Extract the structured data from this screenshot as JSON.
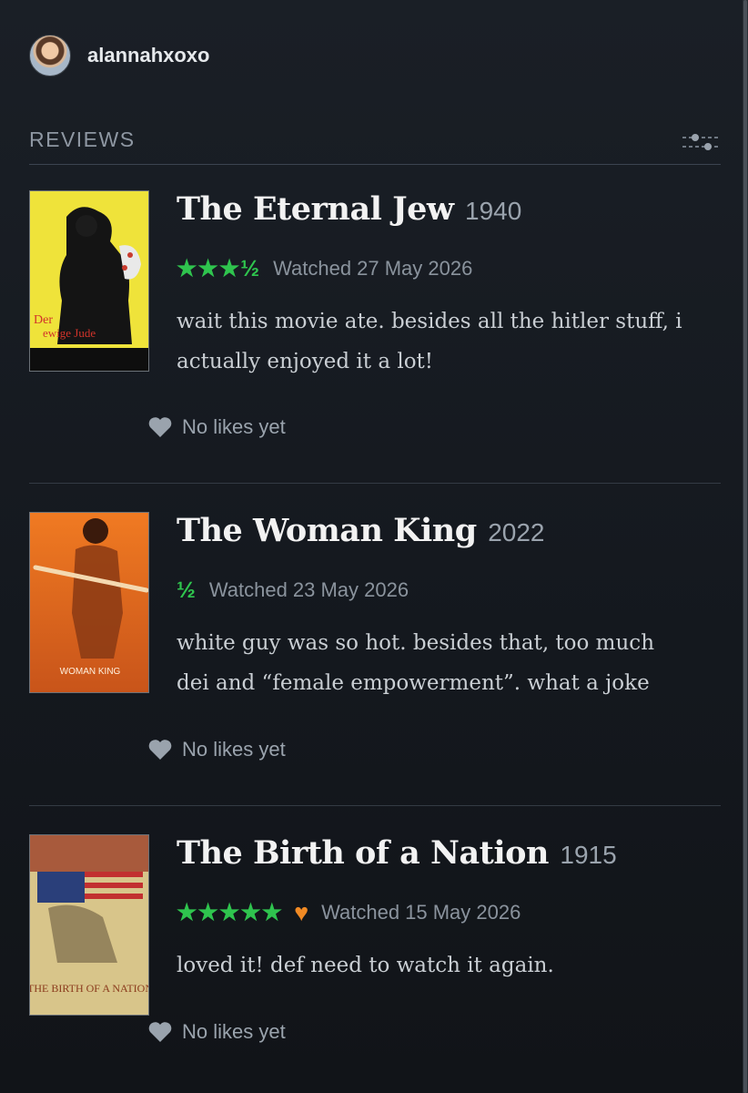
{
  "profile": {
    "username": "alannahxoxo"
  },
  "section": {
    "title": "REVIEWS",
    "filter_icon": "sliders-icon"
  },
  "reviews": [
    {
      "title": "The Eternal Jew",
      "year": "1940",
      "rating_stars": "★★★½",
      "liked": false,
      "watched_label": "Watched",
      "watched_date": "27 May 2026",
      "text_lines": [
        "wait this movie ate. besides all the hitler stuff, i",
        "actually enjoyed it a lot!"
      ],
      "likes_text": "No likes yet",
      "poster": {
        "lettering": "Der ewige Jude"
      }
    },
    {
      "title": "The Woman King",
      "year": "2022",
      "rating_stars": "½",
      "liked": false,
      "watched_label": "Watched",
      "watched_date": "23 May 2026",
      "text_lines": [
        "white guy was so hot. besides that, too much",
        "dei and “female empowerment”. what a joke"
      ],
      "likes_text": "No likes yet",
      "poster": {
        "lettering": "WOMAN KING"
      }
    },
    {
      "title": "The Birth of a Nation",
      "year": "1915",
      "rating_stars": "★★★★★",
      "liked": true,
      "watched_label": "Watched",
      "watched_date": "15 May 2026",
      "text_lines": [
        "loved it! def need to watch it again."
      ],
      "likes_text": "No likes yet",
      "poster": {
        "lettering": "THE BIRTH OF A NATION"
      }
    }
  ],
  "colors": {
    "star_green": "#2fc44e",
    "heart_orange": "#f08a24",
    "background": "#14181e"
  }
}
